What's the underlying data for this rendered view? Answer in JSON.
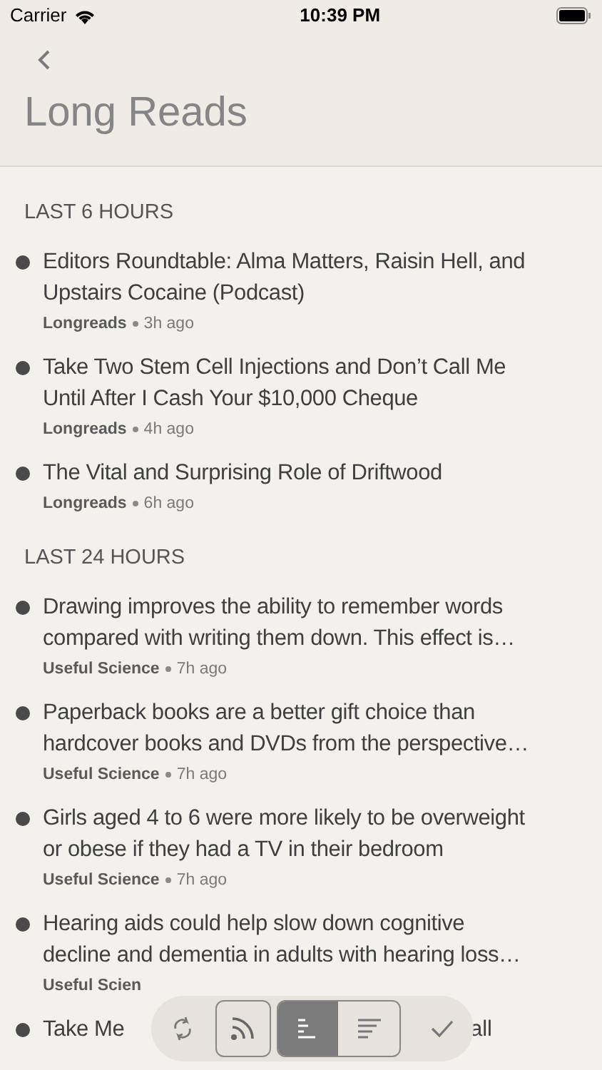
{
  "status_bar": {
    "carrier": "Carrier",
    "time": "10:39 PM"
  },
  "title": "Long Reads",
  "sections": [
    {
      "header": "LAST 6 HOURS",
      "items": [
        {
          "lines": [
            "Editors Roundtable: Alma Matters, Raisin Hell, and",
            "Upstairs Cocaine (Podcast)"
          ],
          "source": "Longreads",
          "age": "3h ago"
        },
        {
          "lines": [
            "Take Two Stem Cell Injections and Don’t Call Me",
            "Until After I Cash Your $10,000 Cheque"
          ],
          "source": "Longreads",
          "age": "4h ago"
        },
        {
          "lines": [
            "The Vital and Surprising Role of Driftwood"
          ],
          "source": "Longreads",
          "age": "6h ago"
        }
      ]
    },
    {
      "header": "LAST 24 HOURS",
      "items": [
        {
          "lines": [
            "Drawing improves the ability to remember words",
            "compared with writing them down. This effect is…"
          ],
          "source": "Useful Science",
          "age": "7h ago"
        },
        {
          "lines": [
            "Paperback books are a better gift choice than",
            "hardcover books and DVDs from the perspective…"
          ],
          "source": "Useful Science",
          "age": "7h ago"
        },
        {
          "lines": [
            "Girls aged 4 to 6 were more likely to be overweight",
            "or obese if they had a TV in their bedroom"
          ],
          "source": "Useful Science",
          "age": "7h ago"
        },
        {
          "lines": [
            "Hearing aids could help slow down cognitive",
            "decline and dementia in adults with hearing loss…"
          ],
          "source": "Useful Scien"
        },
        {
          "lines": [
            "Take Me"
          ],
          "line_end": "all"
        }
      ]
    }
  ],
  "toolbar": {
    "sort_options": [
      {
        "selected": true
      },
      {
        "selected": false
      }
    ]
  }
}
